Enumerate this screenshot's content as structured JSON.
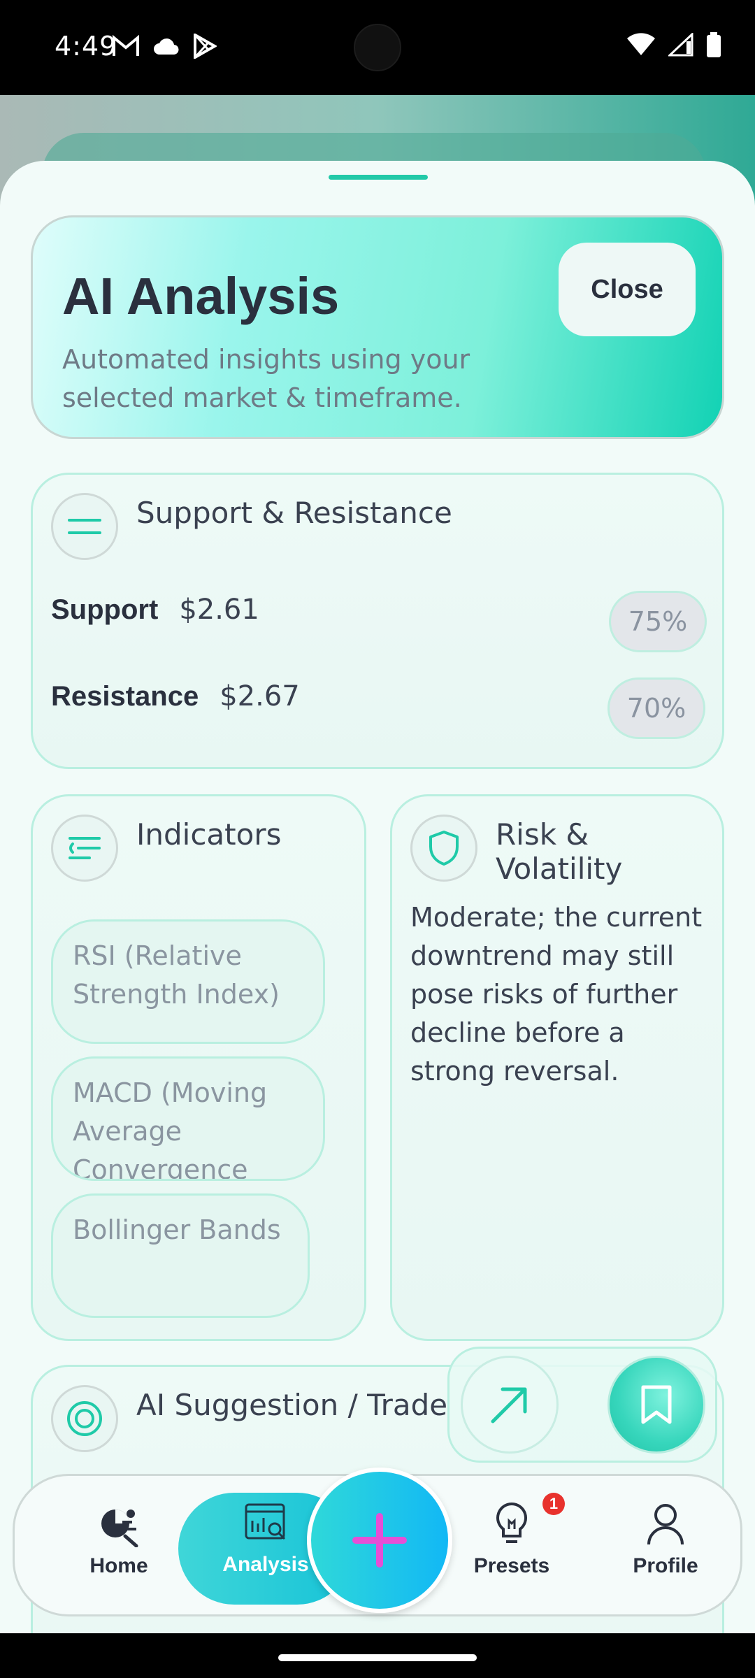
{
  "status_bar": {
    "time": "4:49",
    "left_icons": [
      "gmail-icon",
      "cloud-icon",
      "play-store-icon"
    ],
    "right_icons": [
      "wifi-icon",
      "signal-icon",
      "battery-icon"
    ]
  },
  "header": {
    "title": "AI Analysis",
    "subtitle": "Automated insights using your selected market & timeframe.",
    "close_label": "Close"
  },
  "support_resistance": {
    "title": "Support & Resistance",
    "icon": "equals-lines-icon",
    "rows": [
      {
        "label": "Support",
        "value": "$2.61",
        "confidence": "75%"
      },
      {
        "label": "Resistance",
        "value": "$2.67",
        "confidence": "70%"
      }
    ]
  },
  "indicators": {
    "title": "Indicators",
    "icon": "filter-lines-icon",
    "items": [
      "RSI (Relative Strength Index)",
      "MACD (Moving Average Convergence Divergence)",
      "Bollinger Bands"
    ]
  },
  "risk": {
    "title": "Risk & Volatility",
    "icon": "shield-icon",
    "text": "Moderate; the current downtrend may still pose risks of further decline before a strong reversal."
  },
  "suggestion": {
    "title": "AI Suggestion / Trade",
    "icon": "target-icon"
  },
  "fabs": {
    "arrow_icon": "arrow-up-right-icon",
    "bookmark_icon": "bookmark-icon"
  },
  "nav": {
    "items": [
      {
        "label": "Home",
        "icon": "home-analytics-icon"
      },
      {
        "label": "Analysis",
        "icon": "analysis-icon"
      },
      {
        "label": "Presets",
        "icon": "lightbulb-icon",
        "badge": "1"
      },
      {
        "label": "Profile",
        "icon": "profile-icon"
      }
    ],
    "plus_icon": "plus-icon",
    "accent": "#17c3d8"
  }
}
